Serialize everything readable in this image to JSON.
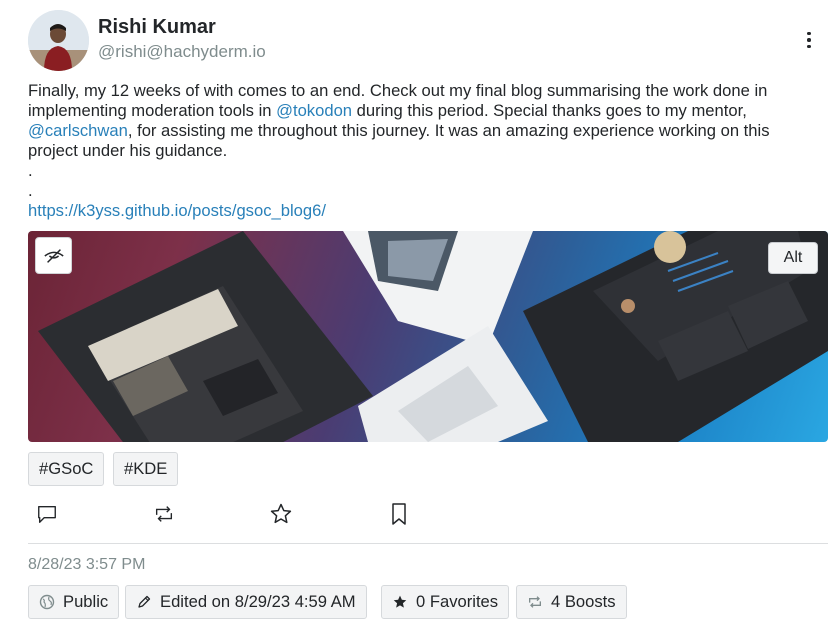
{
  "author": {
    "name": "Rishi Kumar",
    "handle": "@rishi@hachyderm.io"
  },
  "content": {
    "part1": "Finally, my 12 weeks of with comes to an end. Check out my final blog summarising the work done in implementing moderation tools in ",
    "mention1": "@tokodon",
    "part2": " during this period. Special thanks goes to my mentor, ",
    "mention2": "@carlschwan",
    "part3": ", for assisting me throughout this journey. It was an amazing experience working on this project under his guidance.",
    "dot1": ".",
    "dot2": ".",
    "link": "https://k3yss.github.io/posts/gsoc_blog6/"
  },
  "media": {
    "alt_label": "Alt",
    "sensitive_icon": "eye-slash-icon"
  },
  "tags": [
    "#GSoC",
    "#KDE"
  ],
  "actions": {
    "reply_icon": "reply-icon",
    "boost_icon": "boost-icon",
    "favorite_icon": "star-icon",
    "bookmark_icon": "bookmark-icon"
  },
  "timestamp": "8/28/23 3:57 PM",
  "meta": {
    "visibility": "Public",
    "edited": "Edited on 8/29/23 4:59 AM",
    "favorites": "0 Favorites",
    "boosts": "4 Boosts"
  },
  "colors": {
    "link": "#2980b9",
    "muted": "#7f8c8d",
    "text": "#232629"
  }
}
